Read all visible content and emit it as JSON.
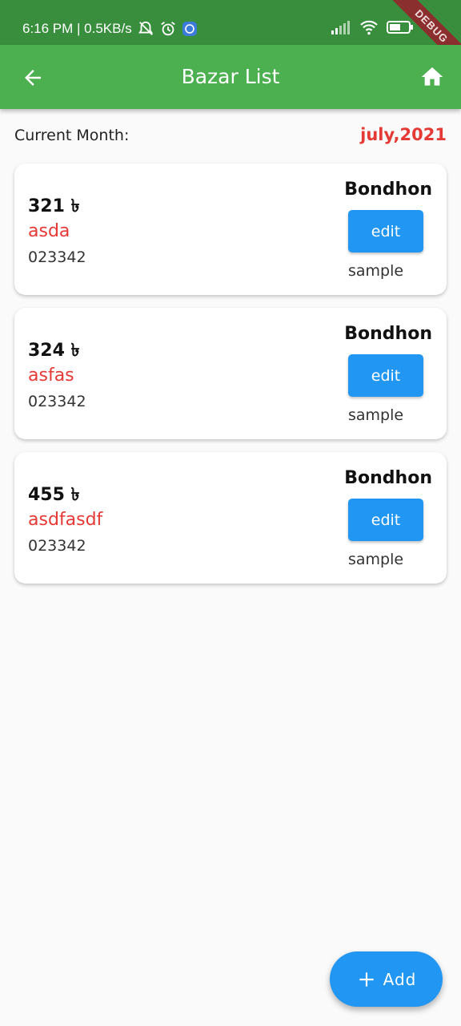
{
  "status_bar": {
    "time_and_speed": "6:16 PM | 0.5KB/s",
    "battery_text": "51",
    "debug_label": "DEBUG"
  },
  "appbar": {
    "title": "Bazar List",
    "back_icon": "arrow-back-icon",
    "home_icon": "home-icon"
  },
  "month": {
    "label": "Current Month:",
    "value": "july,2021"
  },
  "entries": [
    {
      "amount": "321 ৳",
      "item": "asda",
      "phone": "023342",
      "person": "Bondhon",
      "edit_label": "edit",
      "note": "sample"
    },
    {
      "amount": "324 ৳",
      "item": "asfas",
      "phone": "023342",
      "person": "Bondhon",
      "edit_label": "edit",
      "note": "sample"
    },
    {
      "amount": "455 ৳",
      "item": "asdfasdf",
      "phone": "023342",
      "person": "Bondhon",
      "edit_label": "edit",
      "note": "sample"
    }
  ],
  "fab": {
    "label": "Add",
    "icon": "plus-icon"
  },
  "colors": {
    "statusbar": "#388e3c",
    "appbar": "#4caf50",
    "accent_red": "#e53935",
    "button_blue": "#2196f3"
  }
}
